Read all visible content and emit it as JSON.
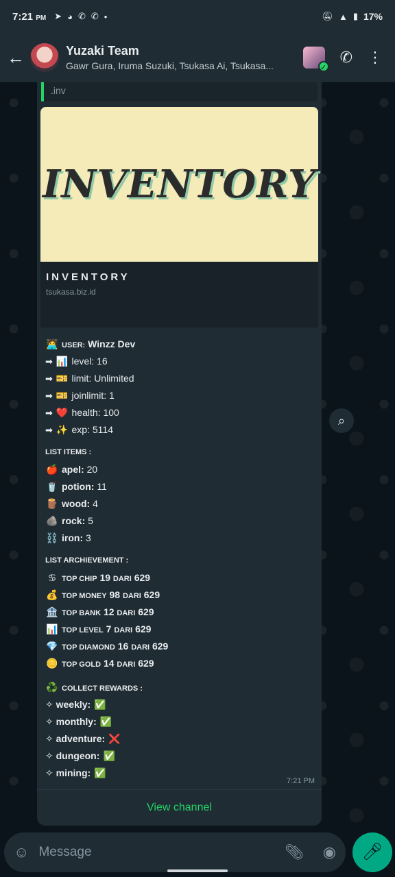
{
  "status_bar": {
    "time": "7:21",
    "ampm": "PM",
    "battery": "17%"
  },
  "header": {
    "title": "Yuzaki Team",
    "subtitle": "Gawr Gura, Iruma Suzuki, Tsukasa Ai, Tsukasa..."
  },
  "message": {
    "quoted": ".inv",
    "banner_text": "INVENTORY",
    "link_title": "INVENTORY",
    "link_url": "tsukasa.biz.id",
    "user": {
      "label": "USER:",
      "name": "Winzz Dev"
    },
    "stats": [
      {
        "icon": "📊",
        "label": "level:",
        "value": "16"
      },
      {
        "icon": "🎫",
        "label": "limit:",
        "value": "Unlimited"
      },
      {
        "icon": "🎫",
        "label": "joinlimit:",
        "value": "1"
      },
      {
        "icon": "❤️",
        "label": "health:",
        "value": "100"
      },
      {
        "icon": "✨",
        "label": "exp:",
        "value": "5114"
      }
    ],
    "items_header": "LIST ITEMS :",
    "items": [
      {
        "icon": "🍎",
        "name": "apel:",
        "value": "20"
      },
      {
        "icon": "🥤",
        "name": "potion:",
        "value": "11"
      },
      {
        "icon": "🪵",
        "name": "wood:",
        "value": "4"
      },
      {
        "icon": "🪨",
        "name": "rock:",
        "value": "5"
      },
      {
        "icon": "⛓️",
        "name": "iron:",
        "value": "3"
      }
    ],
    "achievements_header": "LIST ARCHIEVEMENT :",
    "achievements": [
      {
        "icon": "♋",
        "label": "TOP CHIP",
        "rank": "19",
        "dari": "DARI",
        "total": "629"
      },
      {
        "icon": "💰",
        "label": "TOP MONEY",
        "rank": "98",
        "dari": "DARI",
        "total": "629"
      },
      {
        "icon": "🏦",
        "label": "TOP BANK",
        "rank": "12",
        "dari": "DARI",
        "total": "629"
      },
      {
        "icon": "📊",
        "label": "TOP LEVEL",
        "rank": "7",
        "dari": "DARI",
        "total": "629"
      },
      {
        "icon": "💎",
        "label": "TOP DIAMOND",
        "rank": "16",
        "dari": "DARI",
        "total": "629"
      },
      {
        "icon": "🪙",
        "label": "TOP GOLD",
        "rank": "14",
        "dari": "DARI",
        "total": "629"
      }
    ],
    "rewards_header": "COLLECT REWARDS :",
    "rewards_icon": "♻️",
    "rewards": [
      {
        "name": "weekly:",
        "status": "✅"
      },
      {
        "name": "monthly:",
        "status": "✅"
      },
      {
        "name": "adventure:",
        "status": "❌"
      },
      {
        "name": "dungeon:",
        "status": "✅"
      },
      {
        "name": "mining:",
        "status": "✅"
      }
    ],
    "time": "7:21 PM",
    "view_channel": "View channel"
  },
  "input": {
    "placeholder": "Message"
  },
  "colors": {
    "accent": "#25d366",
    "header_bg": "#1f2c34",
    "chat_bg": "#0b141a",
    "banner_bg": "#f4ebb8"
  }
}
